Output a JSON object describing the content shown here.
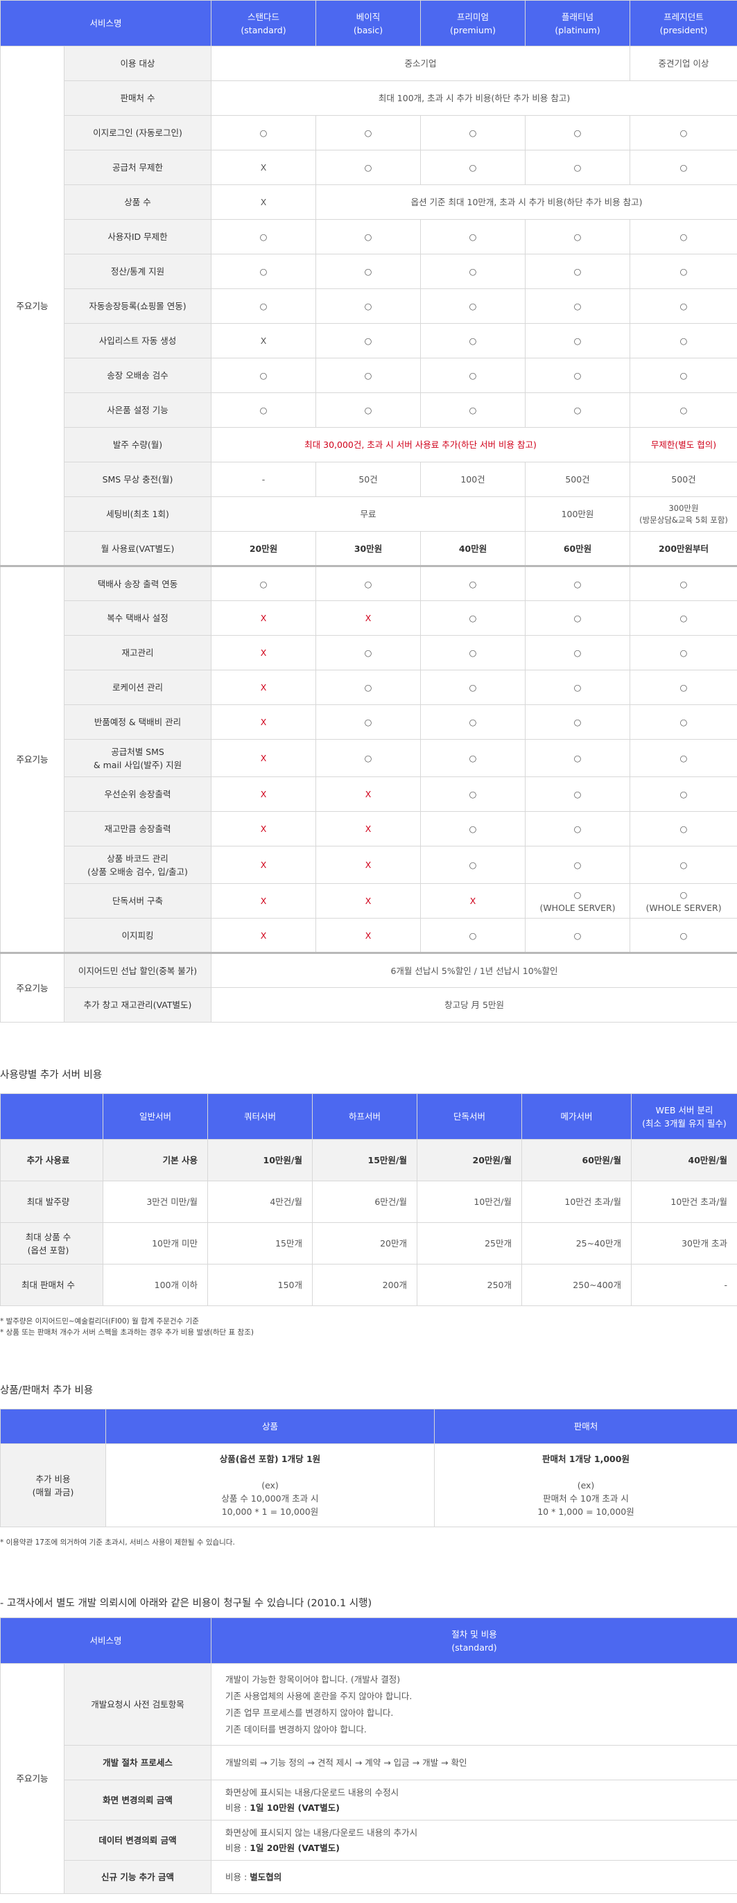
{
  "t1": {
    "header": {
      "c0": "서비스명",
      "c1": "스탠다드\n(standard)",
      "c2": "베이직\n(basic)",
      "c3": "프리미엄\n(premium)",
      "c4": "플래티넘\n(platinum)",
      "c5": "프레지던트\n(president)"
    },
    "group_label": "주요기능",
    "rows": [
      {
        "label": "이용 대상",
        "a": "중소기업",
        "b": "중견기업 이상"
      },
      {
        "label": "판매처 수",
        "a": "최대 100개, 초과 시 추가 비용(하단 추가 비용 참고)"
      },
      {
        "label": "이지로그인 (자동로그인)",
        "cells": [
          "○",
          "○",
          "○",
          "○",
          "○"
        ]
      },
      {
        "label": "공급처 무제한",
        "cells": [
          "X",
          "○",
          "○",
          "○",
          "○"
        ]
      },
      {
        "label": "상품 수",
        "x": "X",
        "a": "옵션 기준 최대 10만개, 초과 시 추가 비용(하단 추가 비용 참고)"
      },
      {
        "label": "사용자ID 무제한",
        "cells": [
          "○",
          "○",
          "○",
          "○",
          "○"
        ]
      },
      {
        "label": "정산/통계 지원",
        "cells": [
          "○",
          "○",
          "○",
          "○",
          "○"
        ]
      },
      {
        "label": "자동송장등록(쇼핑몰 연동)",
        "cells": [
          "○",
          "○",
          "○",
          "○",
          "○"
        ]
      },
      {
        "label": "사입리스트 자동 생성",
        "cells": [
          "X",
          "○",
          "○",
          "○",
          "○"
        ]
      },
      {
        "label": "송장 오배송 검수",
        "cells": [
          "○",
          "○",
          "○",
          "○",
          "○"
        ]
      },
      {
        "label": "사은품 설정 기능",
        "cells": [
          "○",
          "○",
          "○",
          "○",
          "○"
        ]
      },
      {
        "label": "발주 수량(월)",
        "a": "최대 30,000건, 초과 시 서버 사용료 추가(하단 서버 비용 참고)",
        "b": "무제한(별도 협의)"
      },
      {
        "label": "SMS 무상 충전(월)",
        "cells": [
          "-",
          "50건",
          "100건",
          "500건",
          "500건"
        ]
      },
      {
        "label": "세팅비(최초 1회)",
        "a": "무료",
        "c": "100만원",
        "d1": "300만원",
        "d2": "(방문상담&교육 5회 포함)"
      },
      {
        "label": "월 사용료(VAT별도)",
        "cells": [
          "20만원",
          "30만원",
          "40만원",
          "60만원",
          "200만원부터"
        ]
      }
    ],
    "group2_label": "주요기능",
    "rows2": [
      {
        "label": "택배사 송장 출력 연동",
        "cells": [
          "○",
          "○",
          "○",
          "○",
          "○"
        ]
      },
      {
        "label": "복수 택배사 설정",
        "cells": [
          "X",
          "X",
          "○",
          "○",
          "○"
        ]
      },
      {
        "label": "재고관리",
        "cells": [
          "X",
          "○",
          "○",
          "○",
          "○"
        ]
      },
      {
        "label": "로케이션 관리",
        "cells": [
          "X",
          "○",
          "○",
          "○",
          "○"
        ]
      },
      {
        "label": "반품예정 & 택배비 관리",
        "cells": [
          "X",
          "○",
          "○",
          "○",
          "○"
        ]
      },
      {
        "label": "공급처별 SMS\n& mail 사입(발주) 지원",
        "cells": [
          "X",
          "○",
          "○",
          "○",
          "○"
        ]
      },
      {
        "label": "우선순위 송장출력",
        "cells": [
          "X",
          "X",
          "○",
          "○",
          "○"
        ]
      },
      {
        "label": "재고만큼 송장출력",
        "cells": [
          "X",
          "X",
          "○",
          "○",
          "○"
        ]
      },
      {
        "label": "상품 바코드 관리\n(상품 오배송 검수, 입/출고)",
        "cells": [
          "X",
          "X",
          "○",
          "○",
          "○"
        ]
      },
      {
        "label": "단독서버 구축",
        "cells": [
          "X",
          "X",
          "X",
          "○\n(WHOLE SERVER)",
          "○\n(WHOLE SERVER)"
        ]
      },
      {
        "label": "이지피킹",
        "cells": [
          "X",
          "X",
          "○",
          "○",
          "○"
        ]
      }
    ],
    "group3_label": "주요기능",
    "rows3": [
      {
        "label": "이지어드민 선납 할인(중복 불가)",
        "a": "6개월 선납시 5%할인 / 1년 선납시 10%할인"
      },
      {
        "label": "추가 창고 재고관리(VAT별도)",
        "a": "창고당 月 5만원"
      }
    ]
  },
  "t2": {
    "heading": "사용량별 추가 서버 비용",
    "header": [
      "",
      "일반서버",
      "쿼터서버",
      "하프서버",
      "단독서버",
      "메가서버",
      "WEB 서버 분리\n(최소 3개월 유지 필수)"
    ],
    "rows": [
      [
        "추가 사용료",
        "기본 사용",
        "10만원/월",
        "15만원/월",
        "20만원/월",
        "60만원/월",
        "40만원/월"
      ],
      [
        "최대 발주량",
        "3만건 미만/월",
        "4만건/월",
        "6만건/월",
        "10만건/월",
        "10만건 초과/월",
        "10만건 초과/월"
      ],
      [
        "최대 상품 수\n(옵션 포함)",
        "10만개 미만",
        "15만개",
        "20만개",
        "25만개",
        "25~40만개",
        "30만개 초과"
      ],
      [
        "최대 판매처 수",
        "100개 이하",
        "150개",
        "200개",
        "250개",
        "250~400개",
        "-"
      ]
    ],
    "notes": [
      "* 발주량은 이지어드민~예술컬리더(FI00) 월 합계 주문건수 기준",
      "* 상품 또는 판매처 개수가 서버 스펙을 초과하는 경우 추가 비용 발생(하단 표 참조)"
    ]
  },
  "t3": {
    "heading": "상품/판매처 추가 비용",
    "header": [
      "",
      "상품",
      "판매처"
    ],
    "label": "추가 비용\n(매월 과금)",
    "c1": {
      "title": "상품(옵션 포함) 1개당 1원",
      "l1": "(ex)",
      "l2": "상품 수 10,000개 초과 시",
      "l3": "10,000 * 1 = 10,000원"
    },
    "c2": {
      "title": "판매처 1개당 1,000원",
      "l1": "(ex)",
      "l2": "판매처 수 10개 초과 시",
      "l3": "10 * 1,000 = 10,000원"
    },
    "note": "* 이용약관 17조에 의거하여 기준 초과시, 서비스 사용이 제한될 수 있습니다."
  },
  "t4": {
    "heading": "- 고객사에서 별도 개발 의뢰시에 아래와 같은 비용이 청구될 수 있습니다 (2010.1 시행)",
    "header": [
      "서비스명",
      "절차 및 비용\n(standard)"
    ],
    "group_label": "주요기능",
    "r1": {
      "label": "개발요청시 사전 검토항목",
      "lines": [
        "개발이 가능한 항목이어야 합니다. (개발사 결정)",
        "기존 사용업체의 사용에 혼란을 주지 않아야 합니다.",
        "기존 업무 프로세스를 변경하지 않아야 합니다.",
        "기존 데이터를 변경하지 않아야 합니다."
      ]
    },
    "r2": {
      "label": "개발 절차 프로세스",
      "text": "개발의뢰 → 기능 정의 → 견적 제시 → 계약 → 입금 → 개발 → 확인"
    },
    "r3": {
      "label": "화면 변경의뢰 금액",
      "l1": "화면상에 표시되는 내용/다운로드 내용의 수정시",
      "l2a": "비용 : ",
      "l2b": "1일 10만원 (VAT별도)"
    },
    "r4": {
      "label": "데이터 변경의뢰 금액",
      "l1": "화면상에 표시되지 않는 내용/다운로드 내용의 추가시",
      "l2a": "비용 : ",
      "l2b": "1일 20만원 (VAT별도)"
    },
    "r5": {
      "label": "신규 기능 추가 금액",
      "l2a": "비용 : ",
      "l2b": "별도협의"
    }
  },
  "colors": {
    "header_bg": "#4c68f0",
    "label_bg": "#f2f2f2",
    "red": "#d0021b"
  }
}
